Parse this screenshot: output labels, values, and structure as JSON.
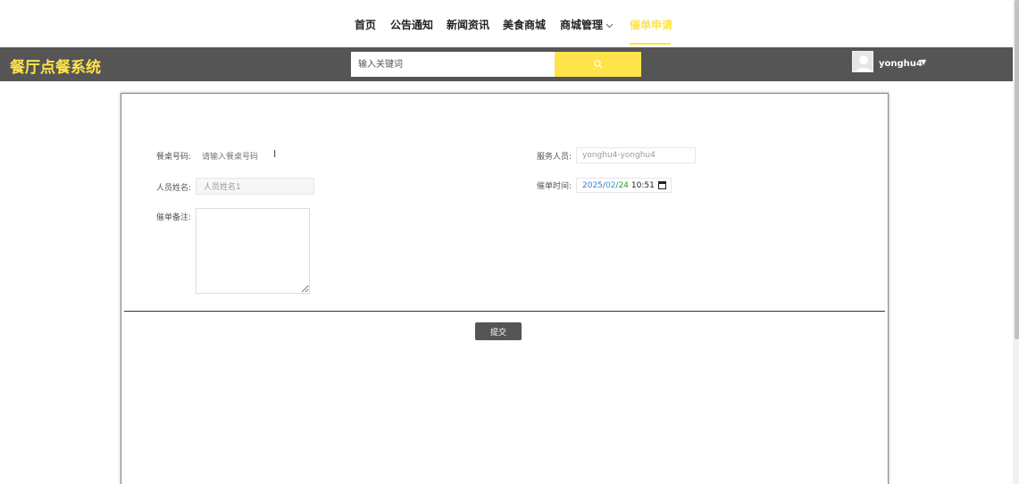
{
  "nav": {
    "items": [
      {
        "label": "首页"
      },
      {
        "label": "公告通知"
      },
      {
        "label": "新闻资讯"
      },
      {
        "label": "美食商城"
      },
      {
        "label": "商城管理"
      },
      {
        "label": "催单申请"
      }
    ],
    "active_index": 5
  },
  "header": {
    "brand": "餐厅点餐系统",
    "search_placeholder": "输入关键词",
    "username": "yonghu4"
  },
  "form": {
    "table_no_label": "餐桌号码:",
    "table_no_placeholder": "请输入餐桌号码",
    "person_name_label": "人员姓名:",
    "person_name_value": "人员姓名1",
    "remark_label": "催单备注:",
    "staff_label": "服务人员:",
    "staff_value": "yonghu4-yonghu4",
    "time_label": "催单时间:",
    "time_year": "2025",
    "time_month": "02",
    "time_day": "24",
    "time_clock": "10:51",
    "submit_label": "提交"
  },
  "colors": {
    "accent": "#ffe34a",
    "header_bg": "#555555"
  }
}
